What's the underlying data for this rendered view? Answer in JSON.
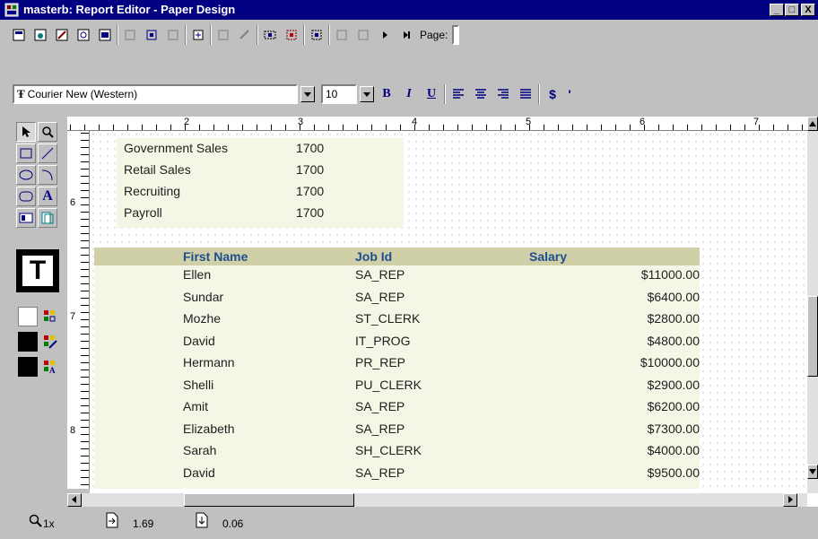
{
  "window": {
    "title": "masterb: Report Editor - Paper Design",
    "min_glyph": "_",
    "max_glyph": "□",
    "close_glyph": "X"
  },
  "toolbar": {
    "page_label": "Page:",
    "font_name": "Courier New (Western)",
    "font_size": "10",
    "bold_label": "B",
    "italic_label": "I",
    "underline_label": "U",
    "currency_label": "$",
    "comma_label": "'"
  },
  "ruler": {
    "marks": [
      "2",
      "3",
      "4",
      "5",
      "6",
      "7"
    ],
    "vertical_marks": [
      "6",
      "7",
      "8"
    ]
  },
  "dept_table": [
    {
      "name": "Government Sales",
      "value": "1700"
    },
    {
      "name": "Retail Sales",
      "value": "1700"
    },
    {
      "name": "Recruiting",
      "value": "1700"
    },
    {
      "name": "Payroll",
      "value": "1700"
    }
  ],
  "emp_table": {
    "headers": [
      "First Name",
      "Job Id",
      "Salary"
    ],
    "rows": [
      {
        "first_name": "Ellen",
        "job_id": "SA_REP",
        "salary": "$11000.00"
      },
      {
        "first_name": "Sundar",
        "job_id": "SA_REP",
        "salary": "$6400.00"
      },
      {
        "first_name": "Mozhe",
        "job_id": "ST_CLERK",
        "salary": "$2800.00"
      },
      {
        "first_name": "David",
        "job_id": "IT_PROG",
        "salary": "$4800.00"
      },
      {
        "first_name": "Hermann",
        "job_id": "PR_REP",
        "salary": "$10000.00"
      },
      {
        "first_name": "Shelli",
        "job_id": "PU_CLERK",
        "salary": "$2900.00"
      },
      {
        "first_name": "Amit",
        "job_id": "SA_REP",
        "salary": "$6200.00"
      },
      {
        "first_name": "Elizabeth",
        "job_id": "SA_REP",
        "salary": "$7300.00"
      },
      {
        "first_name": "Sarah",
        "job_id": "SH_CLERK",
        "salary": "$4000.00"
      },
      {
        "first_name": "David",
        "job_id": "SA_REP",
        "salary": "$9500.00"
      }
    ]
  },
  "status": {
    "zoom": "1x",
    "pos_x": "1.69",
    "pos_y": "0.06"
  },
  "colors": {
    "title_bg": "#000080",
    "chrome": "#c0c0c0",
    "header_band": "#cfcfa8",
    "row_fill": "#f6f6e6",
    "header_text": "#1f4e8f"
  }
}
